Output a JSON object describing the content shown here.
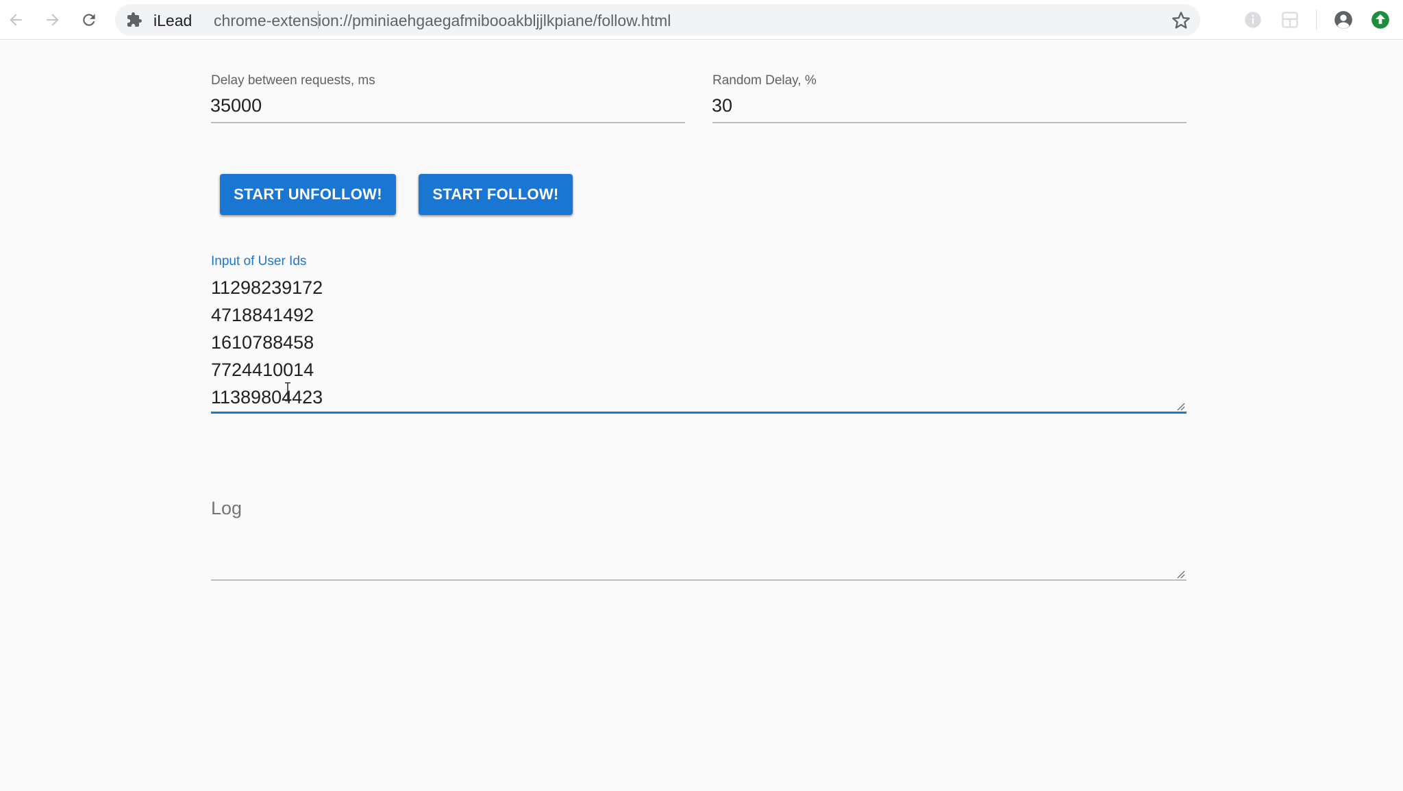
{
  "browser": {
    "site_name": "iLead",
    "url": "chrome-extension://pminiaehgaegafmibooakbljjlkpiane/follow.html"
  },
  "settings": {
    "delay_label": "Delay between requests, ms",
    "delay_value": "35000",
    "random_delay_label": "Random Delay, %",
    "random_delay_value": "30"
  },
  "actions": {
    "unfollow_label": "START UNFOLLOW!",
    "follow_label": "START FOLLOW!"
  },
  "user_ids": {
    "label": "Input of User Ids",
    "lines": [
      "11298239172",
      "4718841492",
      "1610788458",
      "7724410014",
      "11389804423"
    ]
  },
  "log": {
    "label": "Log"
  },
  "colors": {
    "primary": "#1976d2",
    "page_background": "#fafafa",
    "profile_badge": "#1e8e3e"
  },
  "icons": {
    "back": "arrow-left-icon",
    "forward": "arrow-right-icon",
    "reload": "reload-icon",
    "extension": "puzzle-icon",
    "bookmark": "star-icon",
    "info": "info-icon",
    "tab_search": "layout-icon",
    "profile": "account-icon",
    "update": "update-arrow-icon"
  }
}
